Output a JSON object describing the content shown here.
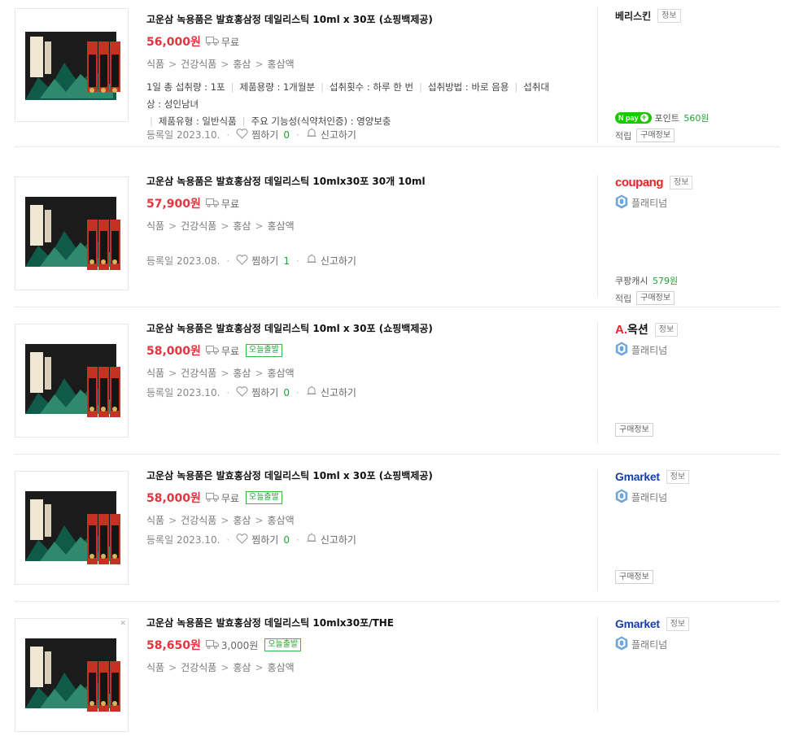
{
  "common": {
    "info_label": "정보",
    "buy_info_label": "구매정보",
    "reward_label": "적립",
    "free_label": "무료",
    "today_ship_label": "오늘출발",
    "reg_label": "등록일",
    "zzim_label": "찜하기",
    "report_label": "신고하기",
    "grade_label": "플래티넘",
    "ad_label": "광고"
  },
  "products": [
    {
      "title": "고운삼 녹용품은 발효홍삼정 데일리스틱 10ml x 30포 (쇼핑백제공)",
      "price": "56,000원",
      "delivery": "무료",
      "today_ship": false,
      "categories": [
        "식품",
        "건강식품",
        "홍삼",
        "홍삼액"
      ],
      "specs": [
        "1일 총 섭취량 : 1포",
        "제품용량 : 1개월분",
        "섭취횟수 : 하루 한 번",
        "섭취방법 : 바로 음용",
        "섭취대상 : 성인남녀",
        "제품유형 : 일반식품",
        "주요 기능성(식약처인증) : 영양보충"
      ],
      "reg_date": "2023.10.",
      "zzim_count": "0",
      "mall": "베리스킨",
      "mall_logo": "text",
      "platinum": false,
      "point_label": "포인트",
      "point_amount": "560원",
      "point_type": "npay",
      "show_reward": true
    },
    {
      "title": "고운삼 녹용품은 발효홍삼정 데일리스틱 10mlx30포 30개 10ml",
      "price": "57,900원",
      "delivery": "무료",
      "today_ship": false,
      "categories": [
        "식품",
        "건강식품",
        "홍삼",
        "홍삼액"
      ],
      "specs": [],
      "reg_date": "2023.08.",
      "zzim_count": "1",
      "mall": "coupang",
      "mall_logo": "coupang",
      "platinum": true,
      "point_label": "쿠팡캐시",
      "point_amount": "579원",
      "point_type": "text",
      "show_reward": true
    },
    {
      "title": "고운삼 녹용품은 발효홍삼정 데일리스틱 10ml x 30포 (쇼핑백제공)",
      "price": "58,000원",
      "delivery": "무료",
      "today_ship": true,
      "categories": [
        "식품",
        "건강식품",
        "홍삼",
        "홍삼액"
      ],
      "specs": [],
      "reg_date": "2023.10.",
      "zzim_count": "0",
      "mall": "옥션",
      "mall_logo": "auction",
      "platinum": true,
      "point_label": "",
      "point_amount": "",
      "point_type": "none",
      "show_reward": false
    },
    {
      "title": "고운삼 녹용품은 발효홍삼정 데일리스틱 10ml x 30포 (쇼핑백제공)",
      "price": "58,000원",
      "delivery": "무료",
      "today_ship": true,
      "categories": [
        "식품",
        "건강식품",
        "홍삼",
        "홍삼액"
      ],
      "specs": [],
      "reg_date": "2023.10.",
      "zzim_count": "0",
      "mall": "Gmarket",
      "mall_logo": "gmarket",
      "platinum": true,
      "point_label": "",
      "point_amount": "",
      "point_type": "none",
      "show_reward": false
    },
    {
      "title": "고운삼 녹용품은 발효홍삼정 데일리스틱 10mlx30포/THE",
      "price": "58,650원",
      "delivery": "3,000원",
      "today_ship": true,
      "categories": [
        "식품",
        "건강식품",
        "홍삼",
        "홍삼액"
      ],
      "specs": [],
      "reg_date": "",
      "zzim_count": "",
      "mall": "Gmarket",
      "mall_logo": "gmarket",
      "platinum": true,
      "point_label": "",
      "point_amount": "",
      "point_type": "none",
      "show_reward": false,
      "ad": true
    }
  ],
  "colors": {
    "price": "#e7333e",
    "green": "#21a337",
    "coupang_red": "#e52528",
    "auction_red": "#e8222a",
    "gmarket_green": "#00a550",
    "gmarket_blue": "#1a3ea8"
  }
}
